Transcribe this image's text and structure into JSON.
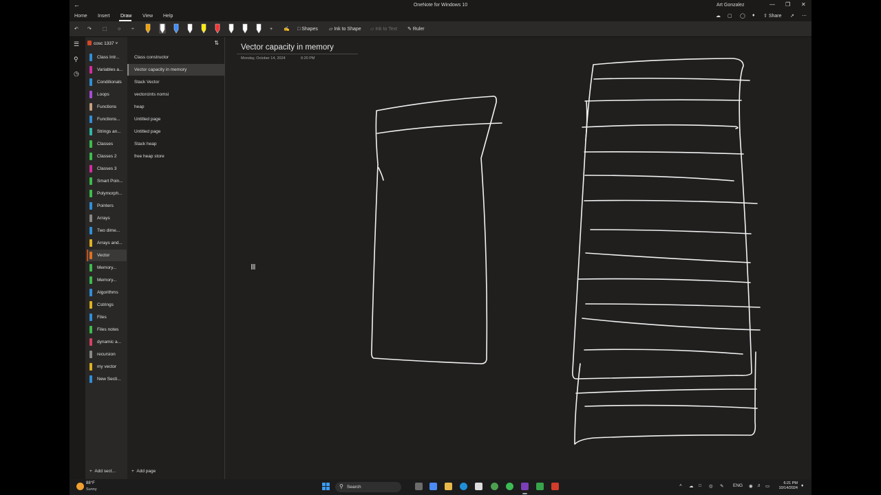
{
  "window": {
    "title": "OneNote for Windows 10",
    "user": "Art Gonzalez"
  },
  "menu": {
    "tabs": [
      "Home",
      "Insert",
      "Draw",
      "View",
      "Help"
    ],
    "active_tab": "Draw",
    "share_label": "Share"
  },
  "toolbar": {
    "shapes_label": "Shapes",
    "ink_to_shape_label": "Ink to Shape",
    "ink_to_text_label": "Ink to Text",
    "ruler_label": "Ruler",
    "pen_colors": [
      "#f0a000",
      "#ffffff",
      "#3c8cff",
      "#ffffff",
      "#ffee00",
      "#ff3030",
      "#ffffff",
      "#ffffff",
      "#ffffff"
    ]
  },
  "notebook": {
    "name": "cosc 1337",
    "add_section_label": "Add sect...",
    "sections": [
      {
        "label": "Class Intr...",
        "color": "#2f8fd8"
      },
      {
        "label": "Variables a...",
        "color": "#d62ca0"
      },
      {
        "label": "Conditionals",
        "color": "#2f8fd8"
      },
      {
        "label": "Loops",
        "color": "#a74bd6"
      },
      {
        "label": "Functions",
        "color": "#c8a080"
      },
      {
        "label": "Functions...",
        "color": "#2f8fd8"
      },
      {
        "label": "Strings an...",
        "color": "#2fb8a8"
      },
      {
        "label": "Classes",
        "color": "#3cbc4c"
      },
      {
        "label": "Classes 2",
        "color": "#3cbc4c"
      },
      {
        "label": "Classes 3",
        "color": "#d62ca0"
      },
      {
        "label": "Smart Poin...",
        "color": "#3cbc4c"
      },
      {
        "label": "Polymorph...",
        "color": "#3cbc4c"
      },
      {
        "label": "Pointers",
        "color": "#2f8fd8"
      },
      {
        "label": "Arrays",
        "color": "#888888"
      },
      {
        "label": "Two dime...",
        "color": "#2f8fd8"
      },
      {
        "label": "Arrays and...",
        "color": "#e0b020"
      },
      {
        "label": "Vector",
        "color": "#e07020"
      },
      {
        "label": "Memory...",
        "color": "#3cbc4c"
      },
      {
        "label": "Memory...",
        "color": "#3cbc4c"
      },
      {
        "label": "Algorithms",
        "color": "#2f8fd8"
      },
      {
        "label": "Cstrings",
        "color": "#e0b020"
      },
      {
        "label": "Files",
        "color": "#2f8fd8"
      },
      {
        "label": "Files notes",
        "color": "#3cbc4c"
      },
      {
        "label": "dynamic a...",
        "color": "#d64060"
      },
      {
        "label": "recursion",
        "color": "#888888"
      },
      {
        "label": "my vector",
        "color": "#e0b020"
      },
      {
        "label": "New Secti...",
        "color": "#2f8fd8"
      }
    ],
    "active_section_index": 16
  },
  "pages": {
    "add_page_label": "Add page",
    "items": [
      "Class constructor",
      "Vector capacity in memory",
      "Stack Vector",
      "vectorcints nomsi",
      "heap",
      "Untitled page",
      "Untitled page",
      "Stack heap",
      "free heap store"
    ],
    "active_index": 1
  },
  "page": {
    "title": "Vector capacity in memory",
    "date": "Monday, October 14, 2024",
    "time": "6:20 PM"
  },
  "taskbar": {
    "temperature": "88°F",
    "condition": "Sunny",
    "search_placeholder": "Search",
    "language": "ENG",
    "clock_time": "6:21 PM",
    "clock_date": "10/14/2024"
  }
}
